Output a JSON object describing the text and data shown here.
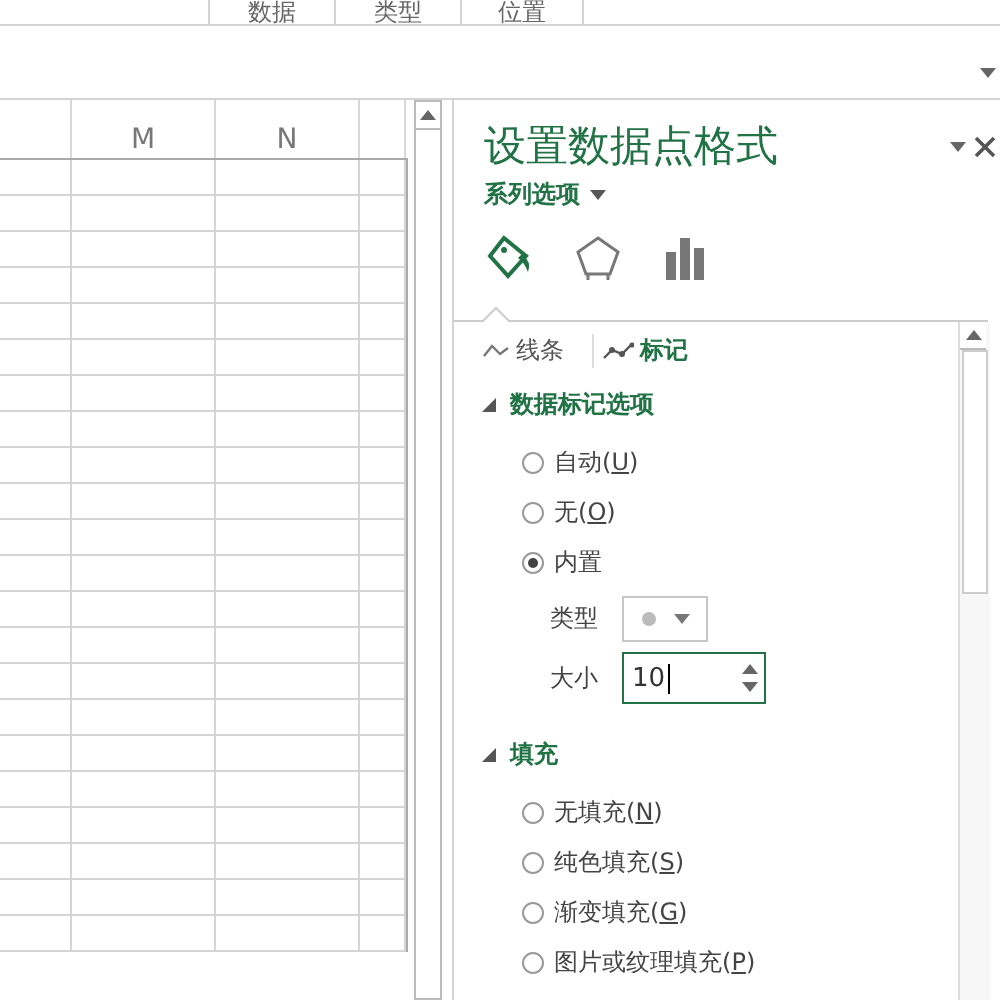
{
  "ribbon": {
    "groups": [
      "数据",
      "类型",
      "位置"
    ]
  },
  "sheet": {
    "columns": [
      "M",
      "N"
    ]
  },
  "pane": {
    "title": "设置数据点格式",
    "series_menu": "系列选项",
    "icon_tabs": [
      {
        "kind": "fill",
        "selected": true
      },
      {
        "kind": "effects",
        "selected": false
      },
      {
        "kind": "series",
        "selected": false
      }
    ],
    "tabs": [
      {
        "kind": "line",
        "label": "线条",
        "selected": false
      },
      {
        "kind": "marker",
        "label": "标记",
        "selected": true
      }
    ],
    "sections": [
      {
        "title": "数据标记选项",
        "expanded": true,
        "options": [
          {
            "label": "自动(",
            "accel": "U",
            "tail": ")",
            "selected": false
          },
          {
            "label": "无(",
            "accel": "O",
            "tail": ")",
            "selected": false
          },
          {
            "label": "内置",
            "selected": true
          }
        ],
        "fields": [
          {
            "kind": "dropdown",
            "label": "类型"
          },
          {
            "kind": "spinner",
            "label": "大小",
            "value": "10"
          }
        ]
      },
      {
        "title": "填充",
        "expanded": true,
        "options": [
          {
            "label": "无填充(",
            "accel": "N",
            "tail": ")",
            "selected": false
          },
          {
            "label": "纯色填充(",
            "accel": "S",
            "tail": ")",
            "selected": false
          },
          {
            "label": "渐变填充(",
            "accel": "G",
            "tail": ")",
            "selected": false
          },
          {
            "label": "图片或纹理填充(",
            "accel": "P",
            "tail": ")",
            "selected": false
          }
        ]
      }
    ]
  }
}
